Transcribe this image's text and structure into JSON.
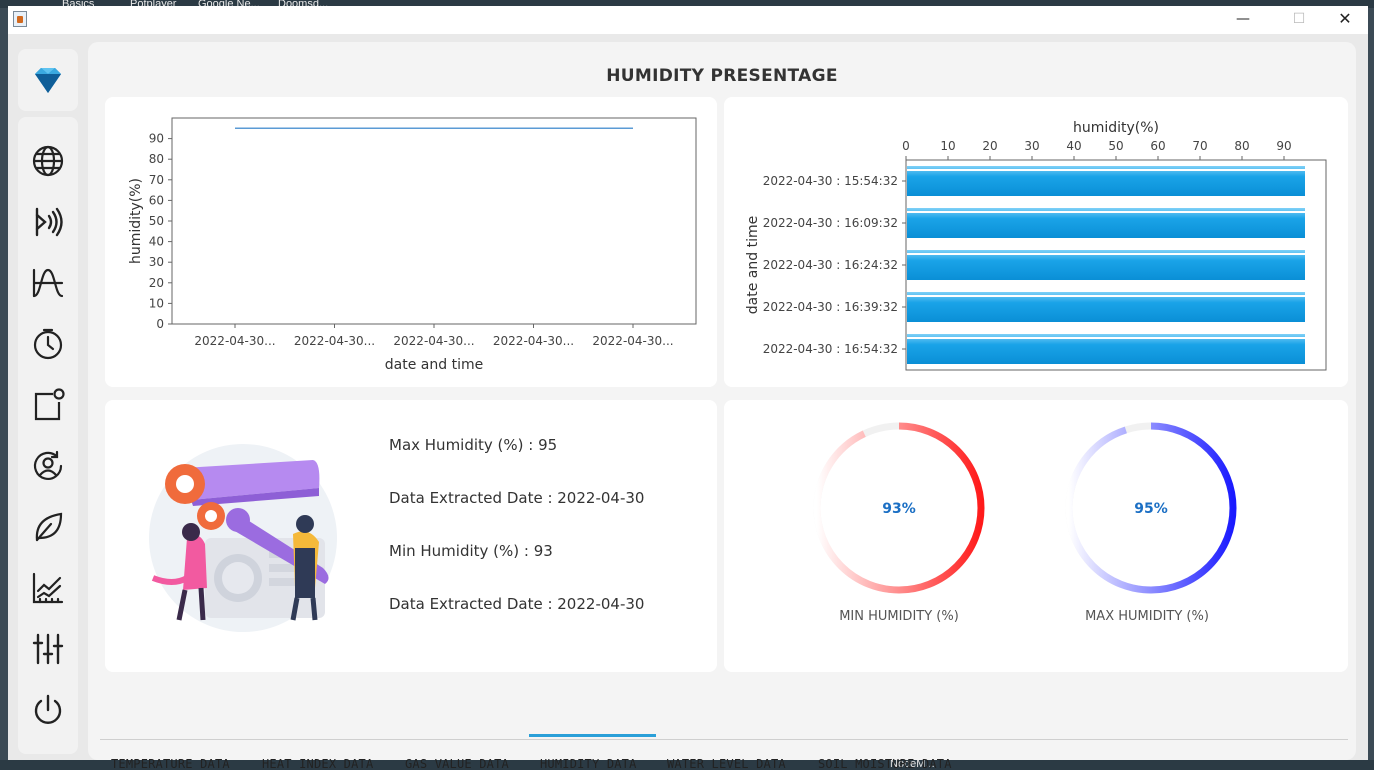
{
  "desktop": {
    "taskbar_items": [
      "Basics",
      "Potplayer",
      "Google Ne...",
      "Doomsd..."
    ],
    "bottom_item": "NodeM..."
  },
  "window": {
    "minimize_symbol": "—",
    "maximize_symbol": "☐",
    "close_symbol": "✕"
  },
  "sidebar": {
    "logo_icon": "diamond-logo-icon",
    "items": [
      {
        "icon": "globe-icon"
      },
      {
        "icon": "sensor-signal-icon"
      },
      {
        "icon": "wave-graph-icon"
      },
      {
        "icon": "timer-icon"
      },
      {
        "icon": "notification-square-icon"
      },
      {
        "icon": "refresh-user-icon"
      },
      {
        "icon": "leaf-icon"
      },
      {
        "icon": "chart-icon"
      },
      {
        "icon": "sliders-icon"
      },
      {
        "icon": "power-icon"
      }
    ]
  },
  "page": {
    "title": "HUMIDITY PRESENTAGE"
  },
  "line_chart": {
    "chart_data": {
      "type": "line",
      "x": [
        "2022-04-30...",
        "2022-04-30...",
        "2022-04-30...",
        "2022-04-30...",
        "2022-04-30..."
      ],
      "series": [
        {
          "values": [
            95,
            95,
            95,
            95,
            95
          ]
        }
      ],
      "xlabel": "date and time",
      "ylabel": "humidity(%)",
      "ylim": [
        0,
        100
      ],
      "yticks": [
        "0",
        "10",
        "20",
        "30",
        "40",
        "50",
        "60",
        "70",
        "80",
        "90"
      ],
      "color": "#5b9bd5"
    }
  },
  "bar_chart": {
    "chart_data": {
      "type": "bar",
      "orientation": "horizontal",
      "categories": [
        "2022-04-30 : 15:54:32",
        "2022-04-30 : 16:09:32",
        "2022-04-30 : 16:24:32",
        "2022-04-30 : 16:39:32",
        "2022-04-30 : 16:54:32"
      ],
      "values": [
        95,
        95,
        95,
        95,
        95
      ],
      "xlabel": "humidity(%)",
      "ylabel": "date and time",
      "xlim": [
        0,
        100
      ],
      "xticks": [
        "0",
        "10",
        "20",
        "30",
        "40",
        "50",
        "60",
        "70",
        "80",
        "90"
      ],
      "color": "#1aa3e8"
    }
  },
  "stats": {
    "max_humidity": "Max Humidity (%) : 95",
    "max_date": "Data Extracted Date : 2022-04-30",
    "min_humidity": "Min Humidity (%) : 93",
    "min_date": "Data Extracted Date : 2022-04-30"
  },
  "gauges": {
    "min": {
      "value_text": "93%",
      "value": 93,
      "label": "MIN HUMIDITY (%)",
      "color": "#ff1a1a"
    },
    "max": {
      "value_text": "95%",
      "value": 95,
      "label": "MAX HUMIDITY (%)",
      "color": "#1a1aff"
    }
  },
  "tabs": [
    {
      "label": "TEMPERATURE DATA"
    },
    {
      "label": "HEAT INDEX DATA"
    },
    {
      "label": "GAS VALUE DATA"
    },
    {
      "label": "HUMIDITY DATA",
      "selected": true
    },
    {
      "label": "WATER LEVEL DATA"
    },
    {
      "label": "SOIL MOISTURE DATA"
    }
  ]
}
